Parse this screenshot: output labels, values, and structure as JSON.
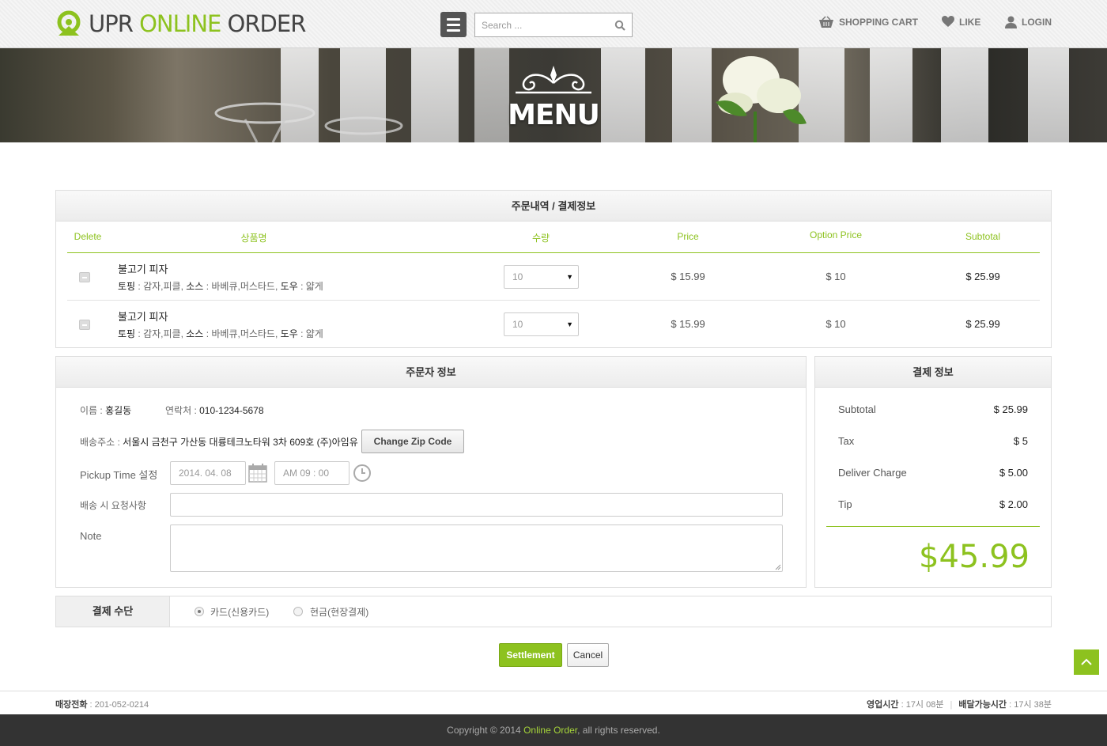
{
  "header": {
    "logo_part1": "UPR ",
    "logo_part2": "ONLINE",
    "logo_part3": " ORDER",
    "search_placeholder": "Search ...",
    "nav": {
      "cart": "SHOPPING CART",
      "like": "LIKE",
      "login": "LOGIN"
    }
  },
  "banner": {
    "title": "MENU"
  },
  "order": {
    "title": "주문내역 / 결제정보",
    "columns": {
      "delete": "Delete",
      "name": "상품명",
      "qty": "수량",
      "price": "Price",
      "option_price": "Option Price",
      "subtotal": "Subtotal"
    },
    "items": [
      {
        "name": "불고기 피자",
        "opt1_label": "토핑",
        "opt1_value": " : 감자,피클, ",
        "opt2_label": "소스",
        "opt2_value": " : 바베큐,머스타드, ",
        "opt3_label": "도우",
        "opt3_value": " : 얇게",
        "qty": "10",
        "price": "$ 15.99",
        "option_price": "$ 10",
        "subtotal": "$ 25.99"
      },
      {
        "name": "불고기 피자",
        "opt1_label": "토핑",
        "opt1_value": " : 감자,피클, ",
        "opt2_label": "소스",
        "opt2_value": " : 바베큐,머스타드, ",
        "opt3_label": "도우",
        "opt3_value": " : 얇게",
        "qty": "10",
        "price": "$ 15.99",
        "option_price": "$ 10",
        "subtotal": "$ 25.99"
      }
    ]
  },
  "orderer": {
    "title": "주문자 정보",
    "name_label": "이름 : ",
    "name_value": "홍길동",
    "contact_label": "연락처 : ",
    "contact_value": "010-1234-5678",
    "address_label": "배송주소 : ",
    "address_value": "서울시 금천구 가산동 대륭테크노타워 3차 609호 (주)아임유",
    "zip_button": "Change Zip Code",
    "pickup_label": "Pickup Time 설정",
    "pickup_date": "2014. 04. 08",
    "pickup_time": "AM 09 : 00",
    "request_label": "배송 시 요청사항",
    "note_label": "Note"
  },
  "payment": {
    "title": "결제 정보",
    "rows": [
      {
        "label": "Subtotal",
        "value": "$ 25.99"
      },
      {
        "label": "Tax",
        "value": "$ 5"
      },
      {
        "label": "Deliver Charge",
        "value": "$ 5.00"
      },
      {
        "label": "Tip",
        "value": "$ 2.00"
      }
    ],
    "total": "$45.99"
  },
  "method": {
    "title": "결제 수단",
    "options": [
      {
        "label": "카드(신용카드)",
        "selected": true
      },
      {
        "label": "현금(현장결제)",
        "selected": false
      }
    ]
  },
  "actions": {
    "settle": "Settlement",
    "cancel": "Cancel"
  },
  "info": {
    "phone_label": "매장전화",
    "phone_value": " : 201-052-0214",
    "hours_label": "영업시간",
    "hours_value": " : 17시 08분",
    "delivery_label": "배달가능시간",
    "delivery_value": " : 17시 38분"
  },
  "footer": {
    "pre": "Copyright © 2014 ",
    "brand": "Online Order",
    "post": ", all rights reserved."
  },
  "colors": {
    "accent": "#8dc21f",
    "footer_bg": "#333333"
  },
  "icons": [
    "logo-icon",
    "menu-icon",
    "search-icon",
    "cart-icon",
    "heart-icon",
    "user-icon",
    "calendar-icon",
    "clock-icon",
    "arrow-up-icon"
  ]
}
